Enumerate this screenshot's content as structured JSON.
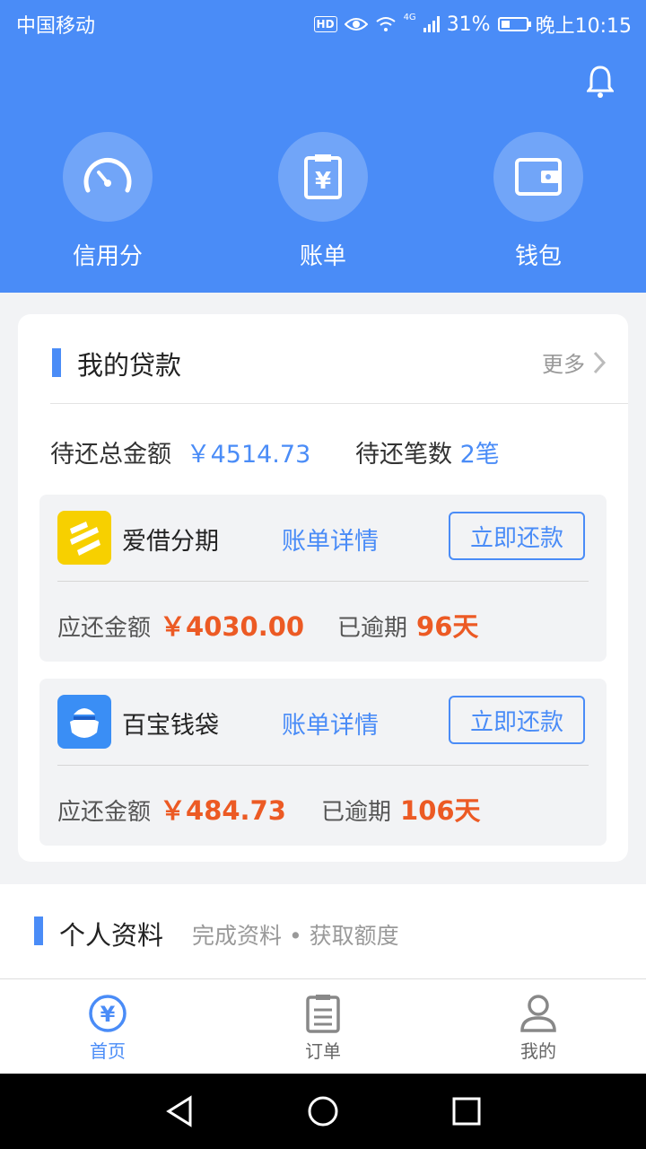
{
  "status_bar": {
    "carrier": "中国移动",
    "hd": "HD",
    "network": "4G",
    "battery": "31%",
    "time": "晚上10:15"
  },
  "header": {
    "nav": [
      {
        "label": "信用分",
        "icon": "speedometer-icon"
      },
      {
        "label": "账单",
        "icon": "bill-yen-icon"
      },
      {
        "label": "钱包",
        "icon": "wallet-icon"
      }
    ]
  },
  "loans": {
    "title": "我的贷款",
    "more": "更多",
    "total_label": "待还总金额",
    "total_value": "￥4514.73",
    "count_label": "待还笔数",
    "count_value": "2笔",
    "items": [
      {
        "name": "爱借分期",
        "detail": "账单详情",
        "repay": "立即还款",
        "due_label": "应还金额",
        "due_value": "￥4030.00",
        "overdue_label": "已逾期",
        "overdue_value": "96天",
        "logo_color": "#f7d000"
      },
      {
        "name": "百宝钱袋",
        "detail": "账单详情",
        "repay": "立即还款",
        "due_label": "应还金额",
        "due_value": "￥484.73",
        "overdue_label": "已逾期",
        "overdue_value": "106天",
        "logo_color": "#3a8ef5"
      }
    ]
  },
  "profile": {
    "title": "个人资料",
    "subtitle": "完成资料 • 获取额度"
  },
  "tabbar": [
    {
      "label": "首页",
      "icon": "home-yen-icon",
      "active": true
    },
    {
      "label": "订单",
      "icon": "order-list-icon",
      "active": false
    },
    {
      "label": "我的",
      "icon": "user-icon",
      "active": false
    }
  ],
  "colors": {
    "primary": "#4a8cf7",
    "accent_red": "#ec5a24"
  }
}
